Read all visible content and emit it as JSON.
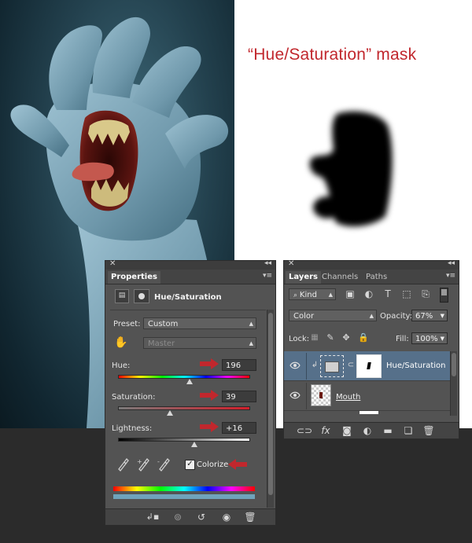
{
  "caption": "“Hue/Saturation” mask",
  "properties": {
    "tab_label": "Properties",
    "adjustment_title": "Hue/Saturation",
    "preset_label": "Preset:",
    "preset_value": "Custom",
    "channel_value": "Master",
    "hue_label": "Hue:",
    "hue_value": "196",
    "saturation_label": "Saturation:",
    "saturation_value": "39",
    "lightness_label": "Lightness:",
    "lightness_value": "+16",
    "colorize_label": "Colorize",
    "colorize_checked": true
  },
  "layers": {
    "tabs": [
      "Layers",
      "Channels",
      "Paths"
    ],
    "kind_label": "Kind",
    "blend_mode": "Color",
    "opacity_label": "Opacity:",
    "opacity_value": "67%",
    "lock_label": "Lock:",
    "fill_label": "Fill:",
    "fill_value": "100%",
    "items": [
      {
        "name": "Hue/Saturation",
        "selected": true
      },
      {
        "name": "Mouth",
        "selected": false
      }
    ]
  },
  "colors": {
    "accent_red": "#c1272d",
    "panel_bg": "#535353",
    "selected_row": "#56708a"
  },
  "icons": {
    "panel_close": "close-icon",
    "panel_collapse": "double-chevron-icon",
    "panel_menu": "panel-menu-icon"
  }
}
